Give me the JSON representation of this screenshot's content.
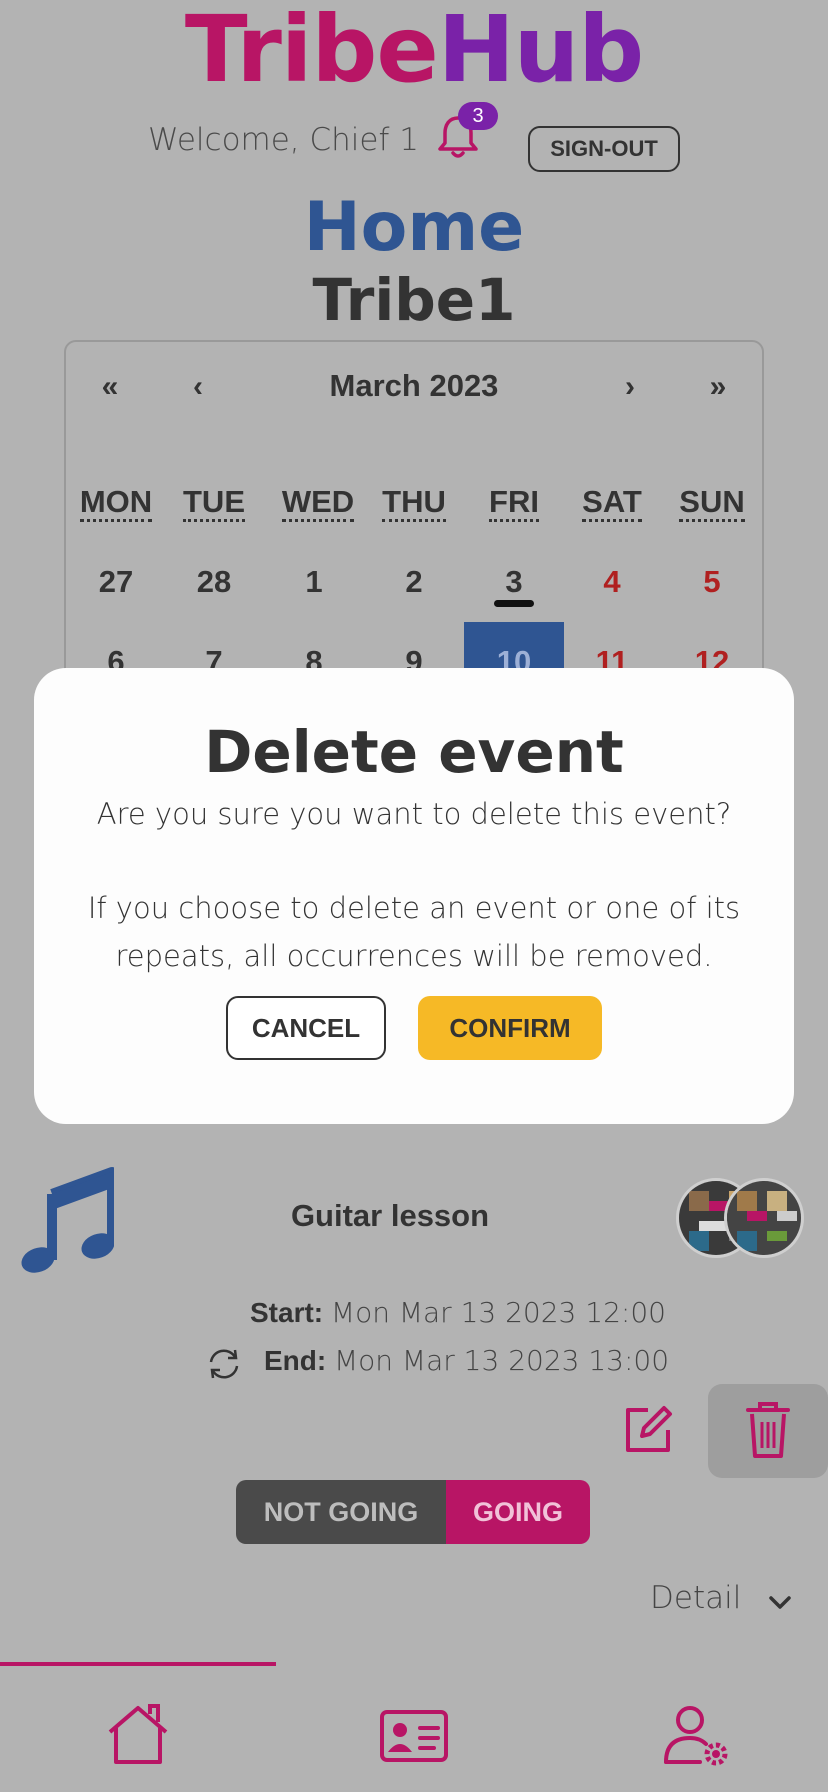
{
  "header": {
    "logo_part1": "Tribe",
    "logo_part2": "Hub",
    "welcome": "Welcome, Chief 1",
    "notification_count": "3",
    "signout_label": "SIGN-OUT"
  },
  "page": {
    "title": "Home",
    "tribe": "Tribe1"
  },
  "calendar": {
    "prev_year": "«",
    "prev_month": "‹",
    "month": "March 2023",
    "next_month": "›",
    "next_year": "»",
    "weekdays": [
      "MON",
      "TUE",
      "WED",
      "THU",
      "FRI",
      "SAT",
      "SUN"
    ],
    "week1": [
      "27",
      "28",
      "1",
      "2",
      "3",
      "4",
      "5"
    ],
    "week2": [
      "6",
      "7",
      "8",
      "9",
      "10",
      "11",
      "12"
    ],
    "today": "3",
    "selected": "10"
  },
  "modal": {
    "title": "Delete event",
    "question": "Are you sure you want to delete this event?",
    "warning_line1": "If you choose to delete an event or one of its",
    "warning_line2": "repeats, all occurrences will be removed.",
    "cancel_label": "CANCEL",
    "confirm_label": "CONFIRM"
  },
  "event": {
    "icon": "music-note-icon",
    "title": "Guitar lesson",
    "start_label": "Start:",
    "start_value": "Mon Mar 13 2023 12:00",
    "end_label": "End:",
    "end_value": "Mon Mar 13 2023 13:00",
    "not_going_label": "NOT GOING",
    "going_label": "GOING",
    "detail_label": "Detail"
  },
  "nav": {
    "items": [
      "home-icon",
      "profile-card-icon",
      "user-settings-icon"
    ]
  },
  "colors": {
    "brand_magenta": "#b81565",
    "brand_purple": "#7a22a8",
    "brand_blue": "#2f5592",
    "confirm_yellow": "#f6b926",
    "weekend_red": "#b02020"
  }
}
